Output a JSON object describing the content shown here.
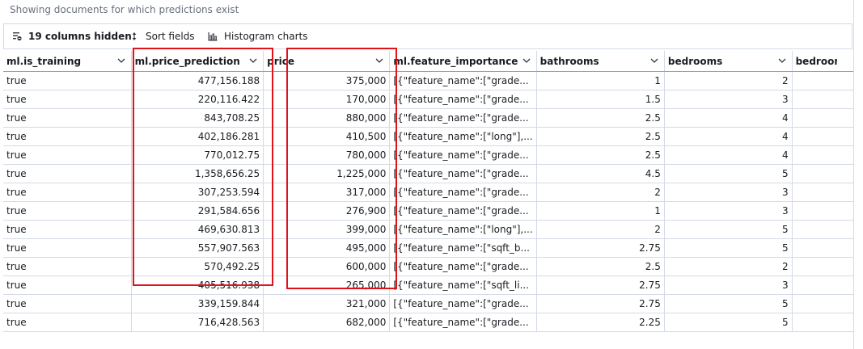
{
  "notice": "Showing documents for which predictions exist",
  "toolbar": {
    "columns_hidden": "19 columns hidden",
    "sort_fields": "Sort fields",
    "histogram_charts": "Histogram charts"
  },
  "columns": [
    "ml.is_training",
    "ml.price_prediction",
    "price",
    "ml.feature_importance",
    "bathrooms",
    "bedrooms",
    "bedrooms"
  ],
  "rows": [
    [
      "true",
      "477,156.188",
      "375,000",
      "[{\"feature_name\":[\"grade...",
      "1",
      "2",
      ""
    ],
    [
      "true",
      "220,116.422",
      "170,000",
      "[{\"feature_name\":[\"grade...",
      "1.5",
      "3",
      ""
    ],
    [
      "true",
      "843,708.25",
      "880,000",
      "[{\"feature_name\":[\"grade...",
      "2.5",
      "4",
      ""
    ],
    [
      "true",
      "402,186.281",
      "410,500",
      "[{\"feature_name\":[\"long\"],...",
      "2.5",
      "4",
      ""
    ],
    [
      "true",
      "770,012.75",
      "780,000",
      "[{\"feature_name\":[\"grade...",
      "2.5",
      "4",
      ""
    ],
    [
      "true",
      "1,358,656.25",
      "1,225,000",
      "[{\"feature_name\":[\"grade...",
      "4.5",
      "5",
      ""
    ],
    [
      "true",
      "307,253.594",
      "317,000",
      "[{\"feature_name\":[\"grade...",
      "2",
      "3",
      ""
    ],
    [
      "true",
      "291,584.656",
      "276,900",
      "[{\"feature_name\":[\"grade...",
      "1",
      "3",
      ""
    ],
    [
      "true",
      "469,630.813",
      "399,000",
      "[{\"feature_name\":[\"long\"],...",
      "2",
      "5",
      ""
    ],
    [
      "true",
      "557,907.563",
      "495,000",
      "[{\"feature_name\":[\"sqft_b...",
      "2.75",
      "5",
      ""
    ],
    [
      "true",
      "570,492.25",
      "600,000",
      "[{\"feature_name\":[\"grade...",
      "2.5",
      "2",
      ""
    ],
    [
      "true",
      "405,516.938",
      "265,000",
      "[{\"feature_name\":[\"sqft_li...",
      "2.75",
      "3",
      ""
    ],
    [
      "true",
      "339,159.844",
      "321,000",
      "[{\"feature_name\":[\"grade...",
      "2.75",
      "5",
      ""
    ],
    [
      "true",
      "716,428.563",
      "682,000",
      "[{\"feature_name\":[\"grade...",
      "2.25",
      "5",
      ""
    ]
  ],
  "colors": {
    "highlight": "#e0131b",
    "border": "#d3dae6",
    "muted_text": "#69707d"
  }
}
